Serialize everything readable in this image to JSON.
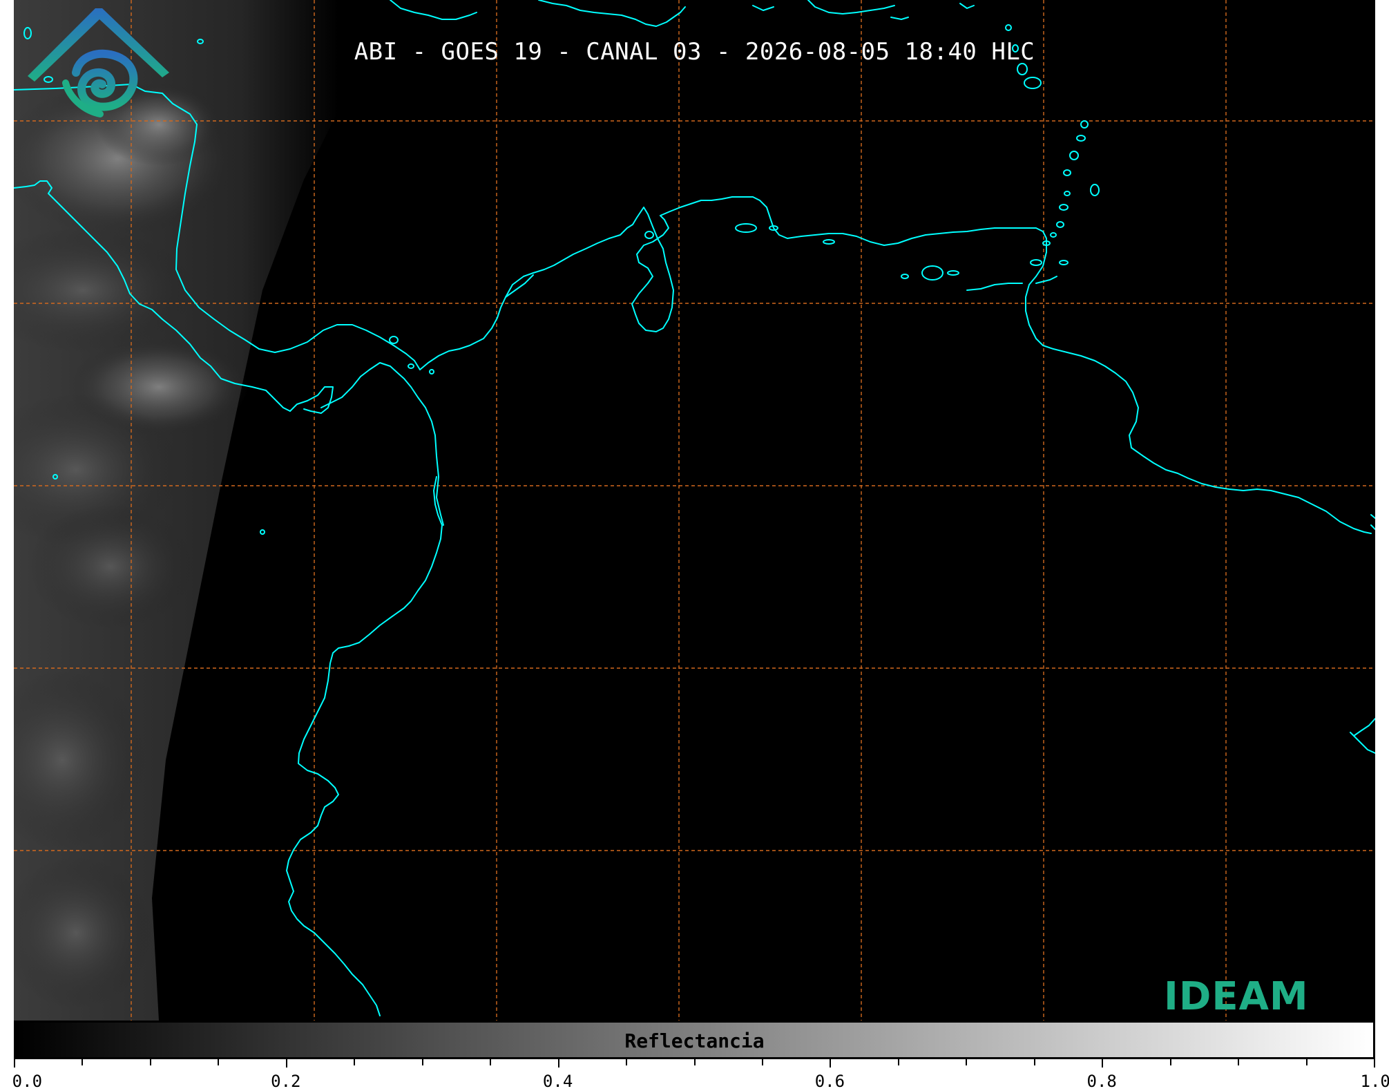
{
  "title": "ABI - GOES 19 - CANAL 03 - 2026-08-05 18:40 HLC",
  "colorbar": {
    "label": "Reflectancia",
    "range": [
      0.0,
      1.0
    ],
    "tick_labels": [
      "0.0",
      "0.2",
      "0.4",
      "0.6",
      "0.8",
      "1.0"
    ],
    "major_ticks": [
      0.0,
      0.2,
      0.4,
      0.6,
      0.8,
      1.0
    ],
    "minor_step": 0.05,
    "colormap": [
      "#000000",
      "#ffffff"
    ]
  },
  "map": {
    "background": "#000000",
    "coastline_color": "#00ffff",
    "gridline_color": "#d2691e",
    "gridline_style": "dashed"
  },
  "logo": {
    "text": "IDEAM",
    "colors": [
      "#2a7fc1",
      "#1fae86"
    ]
  }
}
